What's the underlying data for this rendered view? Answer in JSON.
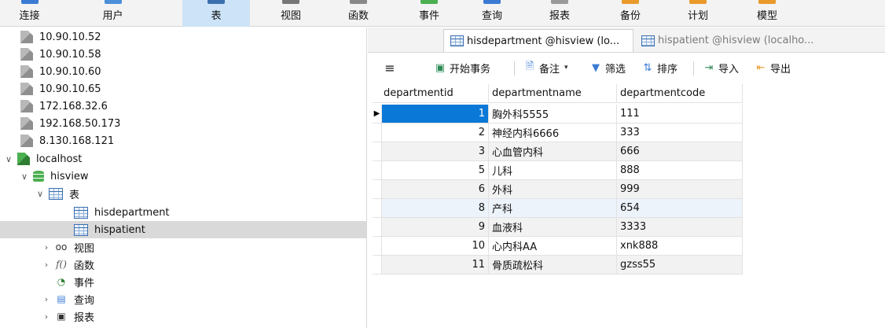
{
  "ribbon": {
    "items": [
      {
        "label": "连接",
        "icon": "connection-icon"
      },
      {
        "label": "用户",
        "icon": "user-icon"
      },
      {
        "label": "表",
        "icon": "table-icon",
        "active": true
      },
      {
        "label": "视图",
        "icon": "view-icon"
      },
      {
        "label": "函数",
        "icon": "function-icon"
      },
      {
        "label": "事件",
        "icon": "event-icon"
      },
      {
        "label": "查询",
        "icon": "query-icon"
      },
      {
        "label": "报表",
        "icon": "report-icon"
      },
      {
        "label": "备份",
        "icon": "backup-icon"
      },
      {
        "label": "计划",
        "icon": "schedule-icon"
      },
      {
        "label": "模型",
        "icon": "model-icon"
      }
    ]
  },
  "tree": {
    "connections": [
      "10.90.10.52",
      "10.90.10.58",
      "10.90.10.60",
      "10.90.10.65",
      "172.168.32.6",
      "192.168.50.173",
      "8.130.168.121"
    ],
    "localhost": "localhost",
    "database": "hisview",
    "tables_folder": "表",
    "tables": [
      "hisdepartment",
      "hispatient"
    ],
    "selected_table": "hispatient",
    "folders": {
      "views": "视图",
      "functions": "函数",
      "events": "事件",
      "queries": "查询",
      "reports": "报表"
    }
  },
  "tabs": [
    {
      "label": "hisdepartment @hisview (lo...",
      "active": true
    },
    {
      "label": "hispatient @hisview (localho...",
      "active": false
    }
  ],
  "toolbar": {
    "begin_transaction": "开始事务",
    "note": "备注",
    "filter": "筛选",
    "sort": "排序",
    "import": "导入",
    "export": "导出"
  },
  "grid": {
    "columns": [
      "departmentid",
      "departmentname",
      "departmentcode"
    ],
    "rows": [
      [
        "1",
        "胸外科5555",
        "111"
      ],
      [
        "2",
        "神经内科6666",
        "333"
      ],
      [
        "3",
        "心血管内科",
        "666"
      ],
      [
        "5",
        "儿科",
        "888"
      ],
      [
        "6",
        "外科",
        "999"
      ],
      [
        "8",
        "产科",
        "654"
      ],
      [
        "9",
        "血液科",
        "3333"
      ],
      [
        "10",
        "心内科AA",
        "xnk888"
      ],
      [
        "11",
        "骨质疏松科",
        "gzss55"
      ]
    ]
  },
  "colors": {
    "ribbon_bg": "#f3f3f3",
    "active_ribbon": "#cde3f7",
    "selection_blue": "#0a78d7",
    "tree_selected": "#d9d9d9"
  }
}
